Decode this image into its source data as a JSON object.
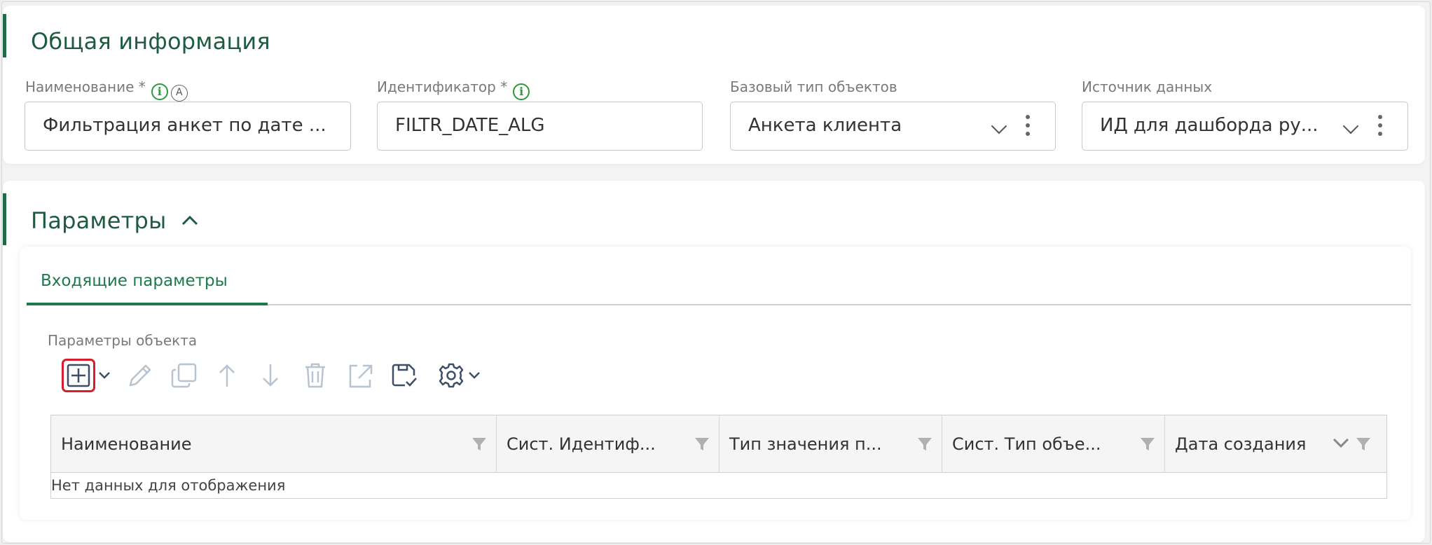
{
  "general": {
    "title": "Общая информация",
    "fields": {
      "name": {
        "label": "Наименование *",
        "value": "Фильтрация анкет по дате ..."
      },
      "identifier": {
        "label": "Идентификатор *",
        "value": "FILTR_DATE_ALG"
      },
      "base_type": {
        "label": "Базовый тип объектов",
        "value": "Анкета клиента"
      },
      "data_source": {
        "label": "Источник данных",
        "value": "ИД для дашборда ру..."
      }
    }
  },
  "parameters": {
    "title": "Параметры",
    "tabs": [
      {
        "label": "Входящие параметры"
      }
    ],
    "subsection_label": "Параметры объекта",
    "toolbar": [
      "add-icon",
      "chevron-down-icon",
      "pencil-icon",
      "copy-icon",
      "arrow-up-icon",
      "arrow-down-icon",
      "trash-icon",
      "open-external-icon",
      "save-check-icon",
      "gear-icon"
    ],
    "table": {
      "columns": [
        {
          "label": "Наименование"
        },
        {
          "label": "Сист. Идентиф..."
        },
        {
          "label": "Тип значения п..."
        },
        {
          "label": "Сист. Тип объе..."
        },
        {
          "label": "Дата создания"
        }
      ],
      "empty_message": "Нет данных для отображения"
    }
  },
  "colors": {
    "accent_green": "#1e6b4a",
    "tab_green": "#1e7a4e",
    "info_green": "#2a9a3a",
    "highlight_red": "#d81d2d",
    "toolbar_icon": "#3d4f66",
    "toolbar_icon_disabled": "#b7c3d0"
  }
}
